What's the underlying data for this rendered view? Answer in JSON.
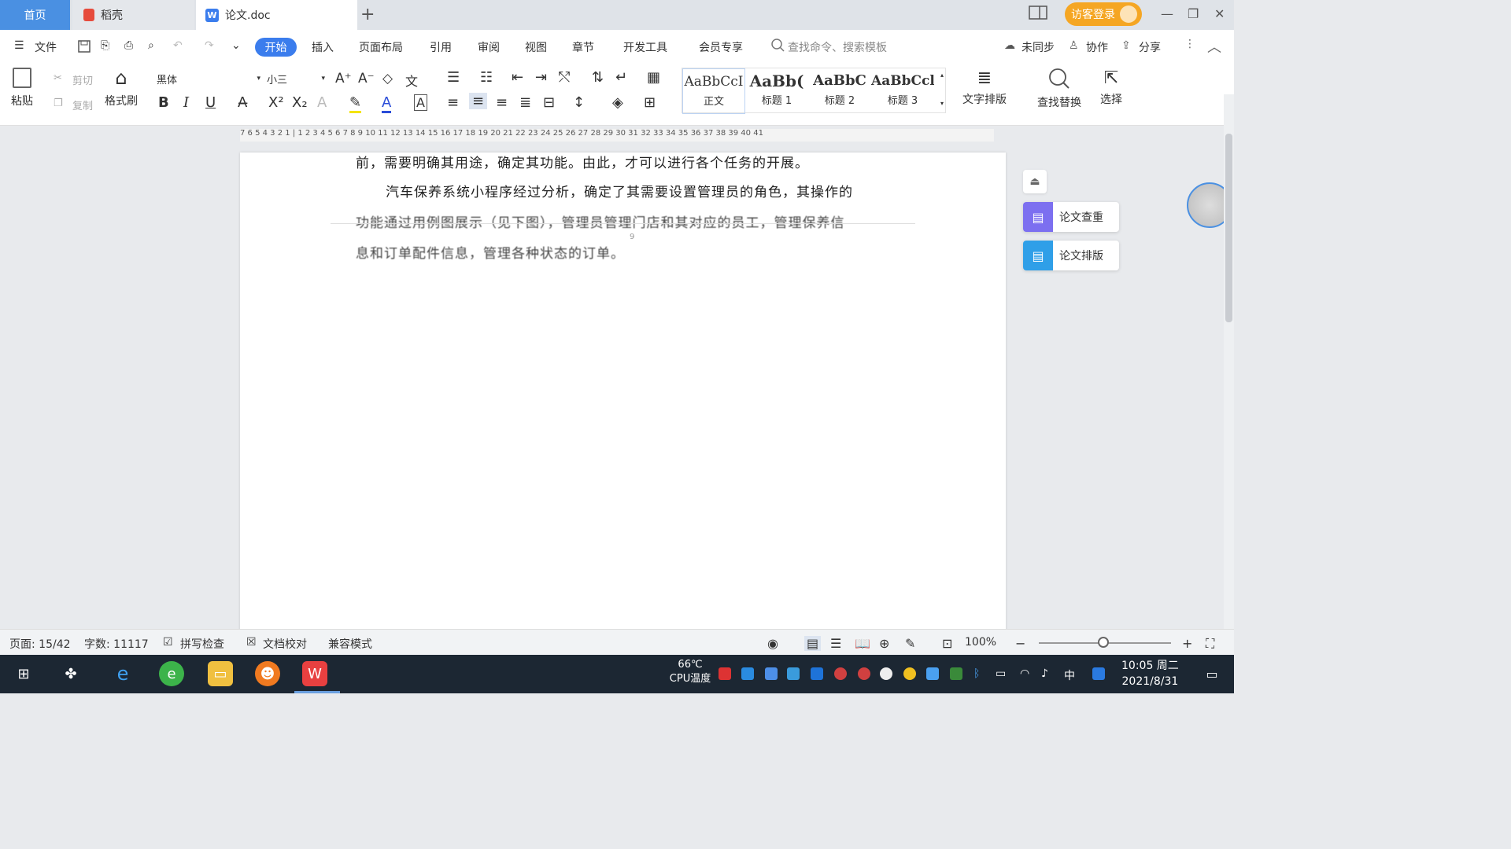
{
  "tabs": {
    "home": "首页",
    "daoke": "稻壳",
    "doc": "论文.doc",
    "doc_icon": "W",
    "add": "+"
  },
  "titlebar": {
    "login": "访客登录"
  },
  "menu": {
    "file": "文件",
    "items": [
      "开始",
      "插入",
      "页面布局",
      "引用",
      "审阅",
      "视图",
      "章节",
      "开发工具",
      "会员专享"
    ],
    "search_placeholder": "查找命令、搜索模板",
    "sync": "未同步",
    "collab": "协作",
    "share": "分享"
  },
  "ribbon": {
    "paste": "粘贴",
    "cut": "剪切",
    "copy": "复制",
    "format_painter": "格式刷",
    "font": "黑体",
    "size": "小三",
    "styles": [
      {
        "sample": "AaBbCcI",
        "label": "正文"
      },
      {
        "sample": "AaBb(",
        "label": "标题 1"
      },
      {
        "sample": "AaBbC",
        "label": "标题 2"
      },
      {
        "sample": "AaBbCcl",
        "label": "标题 3"
      }
    ],
    "text_layout": "文字排版",
    "find_replace": "查找替换",
    "select": "选择"
  },
  "ruler": {
    "ticks": "7 6 5 4 3 2 1 | 1 2 3 4 5 6 7 8 9 10 11 12 13 14 15 16 17 18 19 20 21 22 23 24 25 26 27 28 29 30 31 32 33 34 35 36 37 38 39 40 41"
  },
  "document": {
    "line1": "前，需要明确其用途，确定其功能。由此，才可以进行各个任务的开展。",
    "line2": "汽车保养系统小程序经过分析，确定了其需要设置管理员的角色，其操作的",
    "line3": "功能通过用例图展示（见下图），管理员管理门店和其对应的员工，管理保养信",
    "line4": "息和订单配件信息，管理各种状态的订单。",
    "page_num": "9"
  },
  "side_panel": {
    "check": "论文查重",
    "layout": "论文排版"
  },
  "status": {
    "page": "页面: 15/42",
    "words": "字数: 11117",
    "spell": "拼写检查",
    "proofread": "文档校对",
    "compat": "兼容模式",
    "zoom": "100%"
  },
  "taskbar": {
    "cpu_temp": "66℃",
    "cpu_label": "CPU温度",
    "time": "10:05 周二",
    "date": "2021/8/31",
    "ime": "中"
  }
}
